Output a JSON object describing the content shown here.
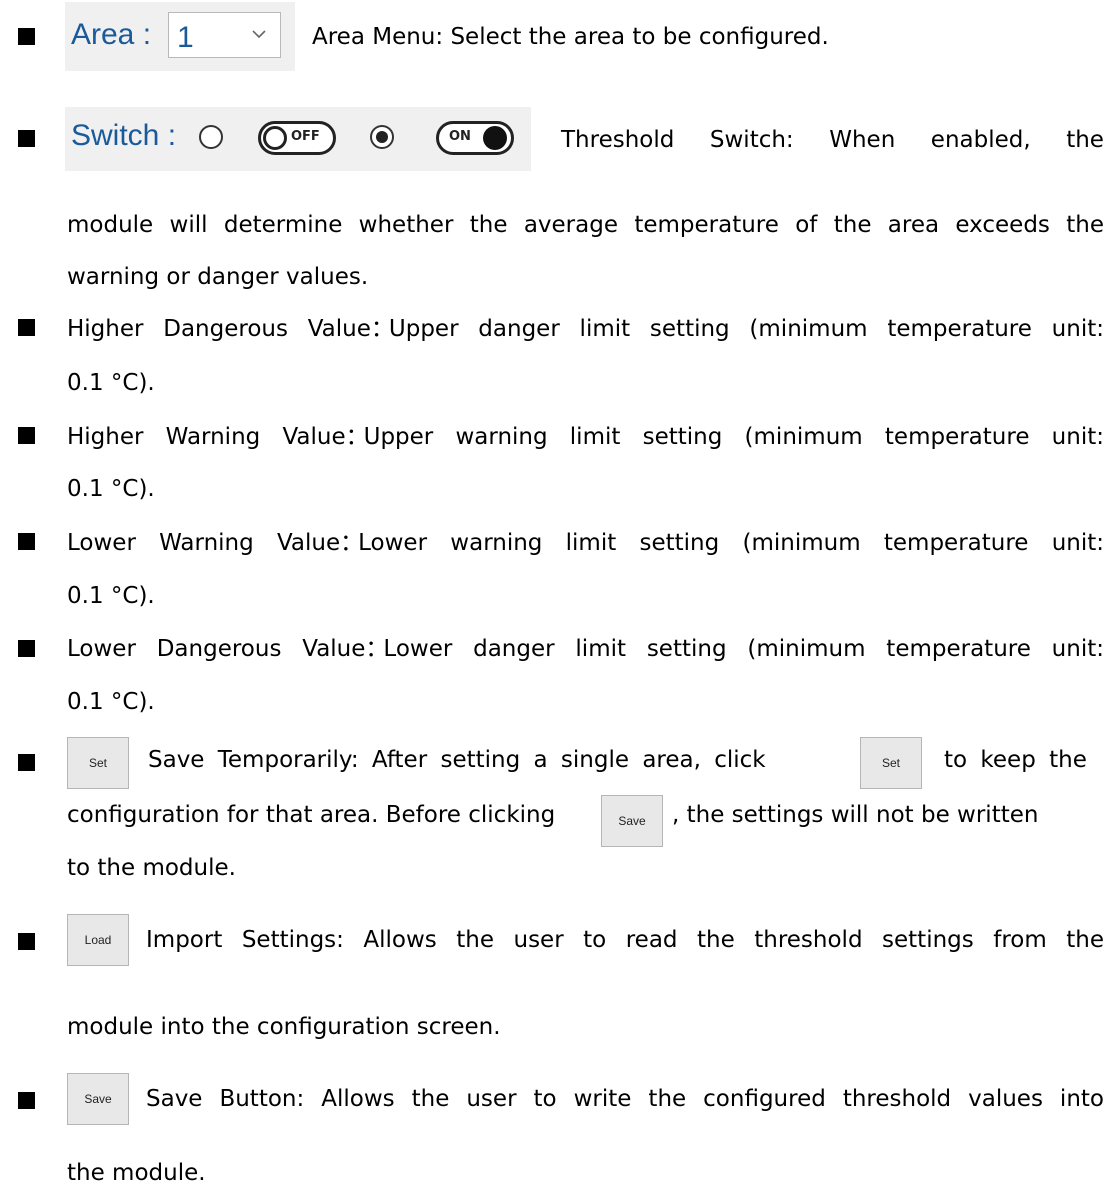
{
  "area_widget": {
    "label": "Area :",
    "value": "1"
  },
  "switch_widget": {
    "label": "Switch :",
    "off_label": "OFF",
    "on_label": "ON",
    "selected": "ON"
  },
  "items": {
    "area_desc": "Area Menu: Select the area to be configured.",
    "switch_desc": {
      "line1_words": [
        "Threshold",
        "Switch:",
        "When",
        "enabled,",
        "the"
      ],
      "line2": "module will determine whether the average temperature of the area exceeds the",
      "line3": "warning or danger values."
    },
    "higher_dangerous": {
      "name": "Higher Dangerous Value",
      "sep": "：",
      "desc": "Upper danger limit setting (minimum temperature unit:",
      "cont": "0.1 °C)."
    },
    "higher_warning": {
      "name": "Higher Warning Value",
      "sep": "：",
      "desc": "Upper warning limit setting (minimum temperature unit:",
      "cont": "0.1 °C)."
    },
    "lower_warning": {
      "name": "Lower Warning Value",
      "sep": "：",
      "desc": "Lower warning limit setting (minimum temperature unit:",
      "cont": "0.1 °C)."
    },
    "lower_dangerous": {
      "name": "Lower Dangerous Value",
      "sep": "：",
      "desc": "Lower danger limit setting (minimum temperature unit:",
      "cont": "0.1 °C)."
    },
    "set_desc": {
      "part1": "Save Temporarily: After setting a single area, click",
      "part2": "to keep the",
      "part3": "configuration for that area. Before clicking",
      "part4": ", the settings will not be written",
      "line3": "to the module."
    },
    "load_desc": {
      "line1": "Import Settings: Allows the user to read the threshold settings from the",
      "line2": "module into the configuration screen."
    },
    "save_desc": {
      "line1": "Save Button: Allows the user to write the configured threshold values into",
      "line2": "the module."
    }
  },
  "buttons": {
    "set": "Set",
    "load": "Load",
    "save": "Save"
  }
}
